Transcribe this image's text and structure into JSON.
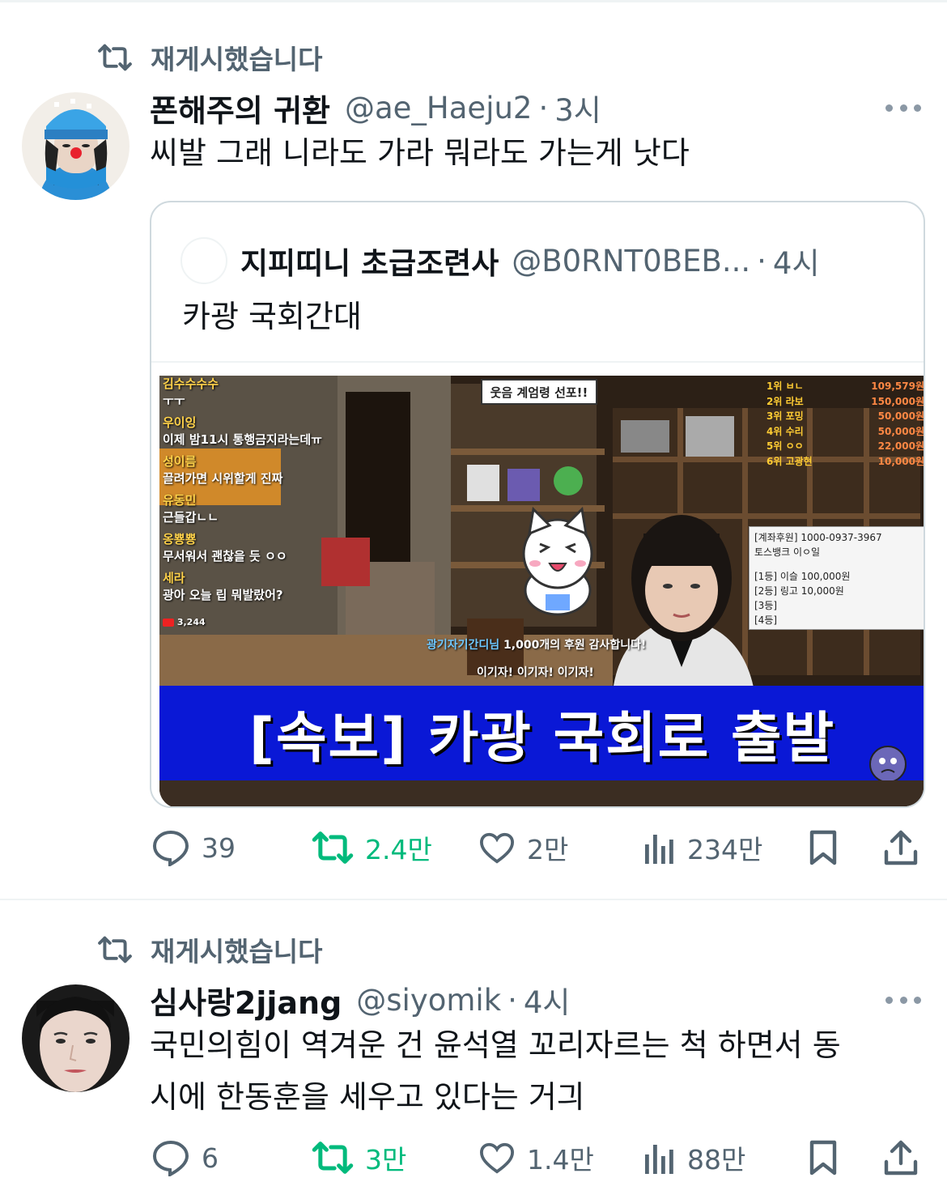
{
  "tweets": [
    {
      "retweet_label": "재게시했습니다",
      "name": "폰해주의 귀환",
      "handle": "@ae_Haeju2",
      "dot": "·",
      "time": "3시",
      "text": "씨발 그래 니라도 가라 뭐라도 가는게 낫다",
      "quote": {
        "name": "지피띠니 초급조련사",
        "handle": "@B0RNT0BEB...",
        "dot": "·",
        "time": "4시",
        "text": "카광 국회간대",
        "media": {
          "chat": [
            {
              "user": "김수수수수",
              "msg": "ㅜㅜ"
            },
            {
              "user": "우이잉",
              "msg": "이제 밤11시 통행금지라는데ㅠ"
            },
            {
              "user": "성이름",
              "msg": "끌려가면 시위할게 진짜"
            },
            {
              "user": "유동민",
              "msg": "근들갑ㄴㄴ"
            },
            {
              "user": "옹뿅뿅",
              "msg": "무서워서 괜찮을 듯 ㅇㅇ"
            },
            {
              "user": "세라",
              "msg": "광아 오늘 립 뭐발랐어?"
            }
          ],
          "viewer_count": "3,244",
          "banner_top": "웃음 계엄령 선포!!",
          "ranking": [
            {
              "rank": "1위",
              "name": "ㅂㄴ",
              "amount": "109,579원"
            },
            {
              "rank": "2위",
              "name": "라보",
              "amount": "150,000원"
            },
            {
              "rank": "3위",
              "name": "포밍",
              "amount": "50,000원"
            },
            {
              "rank": "4위",
              "name": "수리",
              "amount": "50,000원"
            },
            {
              "rank": "5위",
              "name": "ㅇㅇ",
              "amount": "22,000원"
            },
            {
              "rank": "6위",
              "name": "고광현",
              "amount": "10,000원"
            }
          ],
          "donate_box": [
            "[계좌후원] 1000-0937-3967",
            "토스뱅크 이ㅇ일",
            "",
            "[1등] 이슬 100,000원",
            "[2등] 링고 10,000원",
            "[3등]",
            "[4등]"
          ],
          "donation_msg_user": "광기자기간디님",
          "donation_msg_amount": "1,000",
          "donation_msg_rest": "개의 후원 감사합니다!",
          "cheer_msg": "이기자! 이기자! 이기자!",
          "headline": "[속보] 카광 국회로 출발"
        }
      },
      "actions": {
        "replies": "39",
        "retweets": "2.4만",
        "likes": "2만",
        "views": "234만"
      }
    },
    {
      "retweet_label": "재게시했습니다",
      "name": "심사랑2jjang",
      "handle": "@siyomik",
      "dot": "·",
      "time": "4시",
      "text_line1": "국민의힘이 역겨운 건 윤석열 꼬리자르는 척 하면서 동",
      "text_line2": "시에 한동훈을 세우고 있다는 거긔",
      "actions": {
        "replies": "6",
        "retweets": "3만",
        "likes": "1.4만",
        "views": "88만"
      }
    }
  ],
  "colors": {
    "retweet_green": "#00ba7c",
    "secondary_text": "#536471",
    "banner_blue": "#0a18d6"
  }
}
